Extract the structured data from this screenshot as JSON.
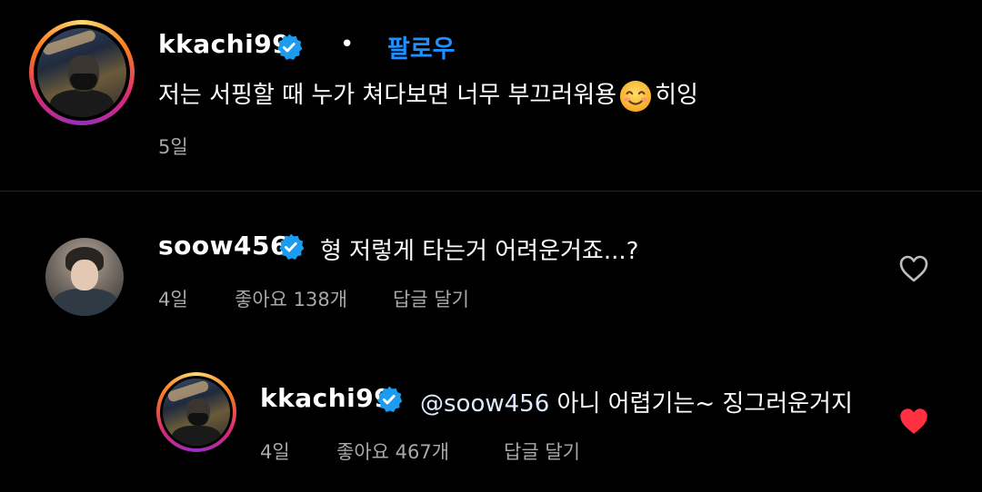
{
  "post": {
    "username": "kkachi99",
    "follow_label": "팔로우",
    "separator": "•",
    "caption_before": "저는 서핑할 때 누가 쳐다보면 너무 부끄러워용",
    "caption_emoji": "smiling-face-with-smiling-eyes-emoji",
    "caption_after": "히잉",
    "time": "5일"
  },
  "comments": [
    {
      "username": "soow456",
      "text": "형 저렇게 타는거 어려운거죠...?",
      "time": "4일",
      "likes": "좋아요 138개",
      "reply_label": "답글 달기",
      "liked": false
    }
  ],
  "reply": {
    "username": "kkachi99",
    "mention": "@soow456",
    "text": " 아니 어렵기는~ 징그러운거지",
    "time": "4일",
    "likes": "좋아요 467개",
    "reply_label": "답글 달기",
    "liked": true
  },
  "colors": {
    "background": "#000000",
    "accent_blue": "#1e90ff",
    "verified_blue": "#1c9bef",
    "liked_red": "#ff3040",
    "meta_gray": "#a8a8a8"
  }
}
